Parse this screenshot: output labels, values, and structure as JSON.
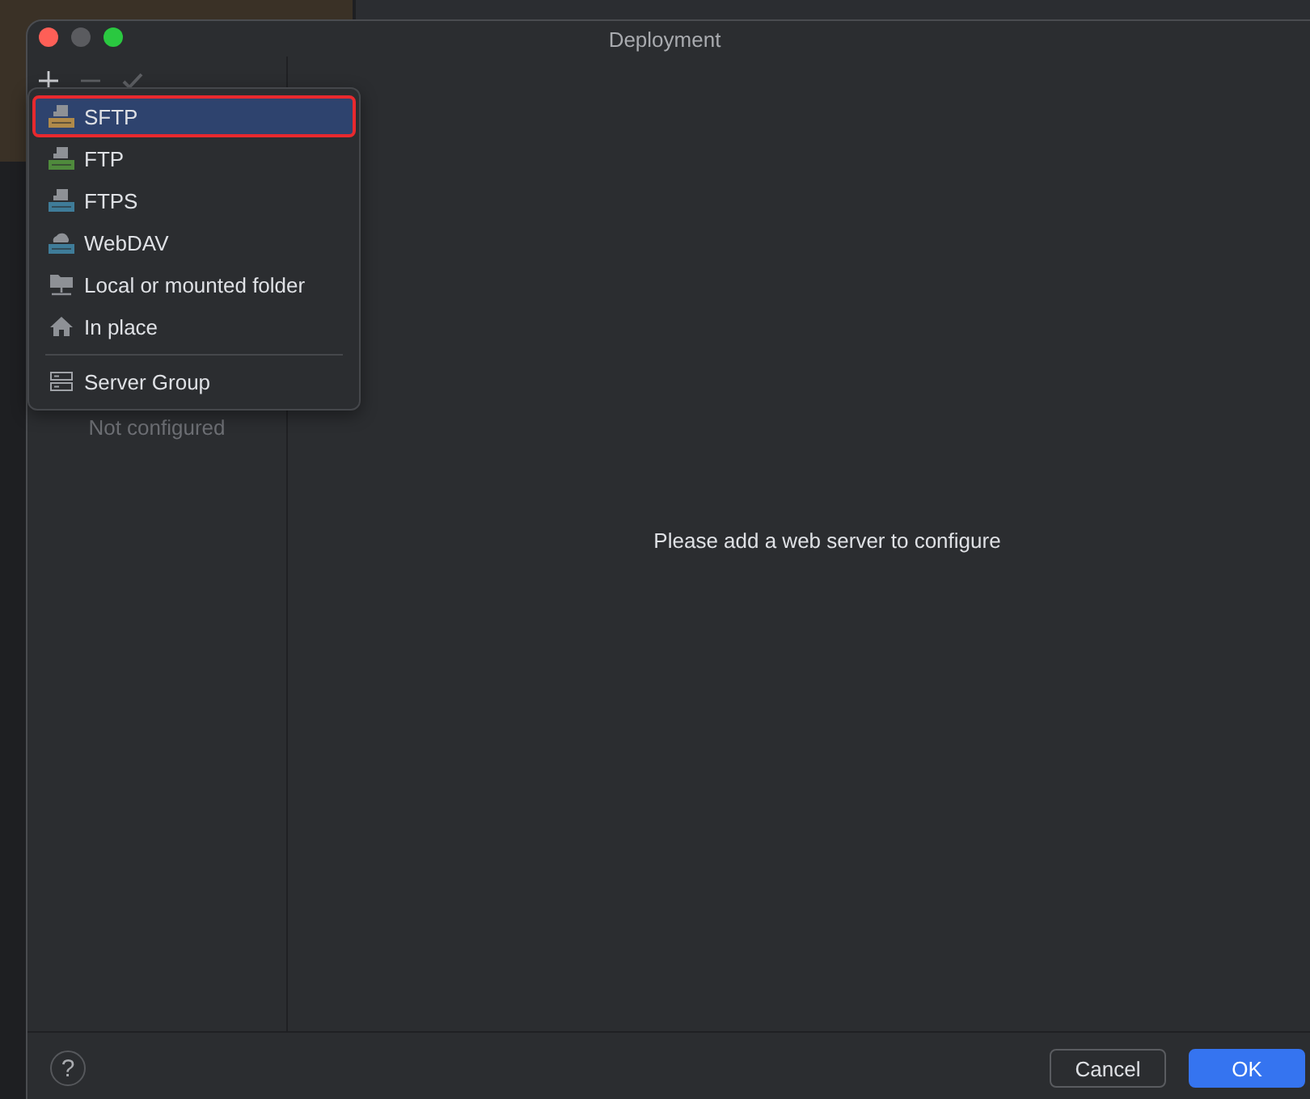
{
  "window": {
    "title": "Deployment"
  },
  "toolbar": [
    {
      "kind": "add",
      "disabled": false
    },
    {
      "kind": "remove",
      "disabled": true
    },
    {
      "kind": "apply",
      "disabled": true
    }
  ],
  "sidebar": {
    "empty_text": "Not configured"
  },
  "menu": {
    "sections": [
      [
        {
          "label": "SFTP",
          "kind": "sftp",
          "selected": true
        },
        {
          "label": "FTP",
          "kind": "ftp",
          "selected": false
        },
        {
          "label": "FTPS",
          "kind": "ftps",
          "selected": false
        },
        {
          "label": "WebDAV",
          "kind": "webdav",
          "selected": false
        },
        {
          "label": "Local or mounted folder",
          "kind": "folder",
          "selected": false
        },
        {
          "label": "In place",
          "kind": "home",
          "selected": false
        }
      ],
      [
        {
          "label": "Server Group",
          "kind": "group",
          "selected": false
        }
      ]
    ]
  },
  "main": {
    "message": "Please add a web server to configure"
  },
  "footer": {
    "help": "?",
    "buttons": [
      {
        "label": "Cancel",
        "default": false
      },
      {
        "label": "OK",
        "default": true
      }
    ]
  }
}
